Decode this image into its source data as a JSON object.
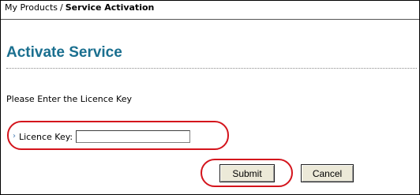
{
  "breadcrumb": {
    "parent": "My Products",
    "separator": "/",
    "current": "Service Activation"
  },
  "page": {
    "title": "Activate Service",
    "instruction": "Please Enter the Licence Key"
  },
  "form": {
    "licence_label": "Licence Key:",
    "licence_value": "",
    "submit_label": "Submit",
    "cancel_label": "Cancel"
  },
  "icons": {
    "field_marker": "chevron-right-icon"
  },
  "colors": {
    "title": "#1a6f8f",
    "highlight_ring": "#d4141c"
  }
}
